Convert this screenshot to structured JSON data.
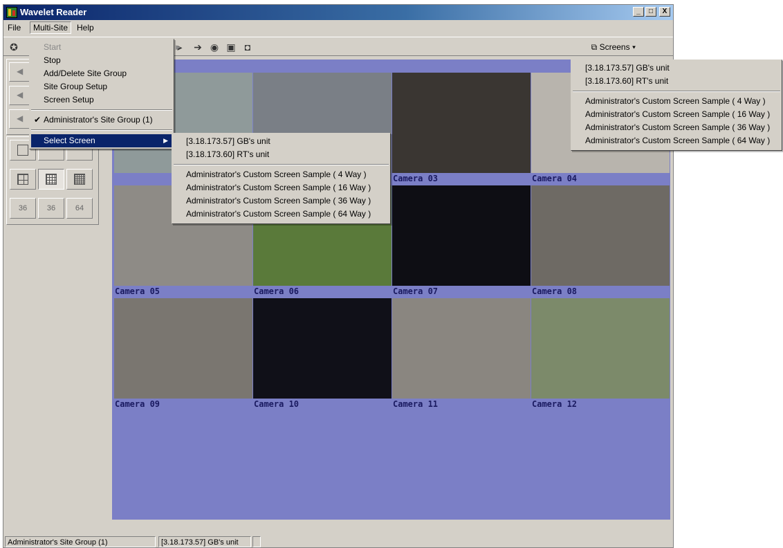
{
  "window": {
    "title": "Wavelet Reader",
    "controls": [
      "_",
      "□",
      "X"
    ]
  },
  "menubar": {
    "items": [
      "File",
      "Multi-Site",
      "Help"
    ]
  },
  "toolbar": {
    "screens_label": "Screens"
  },
  "multisite_menu": {
    "items": [
      {
        "label": "Start",
        "disabled": true,
        "submenu": true
      },
      {
        "label": "Stop"
      },
      {
        "label": "Add/Delete Site Group"
      },
      {
        "label": "Site Group Setup"
      },
      {
        "label": "Screen Setup"
      },
      {
        "label": "Administrator's Site Group (1)",
        "checked": true
      },
      {
        "label": "Select Screen",
        "highlighted": true,
        "submenu": true
      }
    ]
  },
  "select_screen_submenu": {
    "units": [
      "[3.18.173.57] GB's unit",
      "[3.18.173.60] RT's unit"
    ],
    "screens": [
      "Administrator's Custom Screen Sample ( 4 Way )",
      "Administrator's Custom Screen Sample ( 16 Way )",
      "Administrator's Custom Screen Sample ( 36 Way )",
      "Administrator's Custom Screen Sample ( 64 Way )"
    ]
  },
  "screens_dropdown": {
    "units": [
      "[3.18.173.57] GB's unit",
      "[3.18.173.60] RT's unit"
    ],
    "screens": [
      "Administrator's Custom Screen Sample ( 4 Way )",
      "Administrator's Custom Screen Sample ( 16 Way )",
      "Administrator's Custom Screen Sample ( 36 Way )",
      "Administrator's Custom Screen Sample ( 64 Way )"
    ]
  },
  "left_panel": {
    "layout_buttons": [
      "36",
      "36",
      "64"
    ]
  },
  "cameras": [
    {
      "label": "",
      "color": "#8f9a9a"
    },
    {
      "label": "",
      "color": "#7a7f86"
    },
    {
      "label": "Camera 03",
      "color": "#3a3632"
    },
    {
      "label": "Camera 04",
      "color": "#b8b4ad"
    },
    {
      "label": "Camera 05",
      "color": "#8e8b86"
    },
    {
      "label": "Camera 06",
      "color": "#5a7a3a"
    },
    {
      "label": "Camera 07",
      "color": "#0e0e14"
    },
    {
      "label": "Camera 08",
      "color": "#6e6a64"
    },
    {
      "label": "Camera 09",
      "color": "#7a7670"
    },
    {
      "label": "Camera 10",
      "color": "#101018"
    },
    {
      "label": "Camera 11",
      "color": "#8a8680"
    },
    {
      "label": "Camera 12",
      "color": "#7c8a6a"
    }
  ],
  "statusbar": {
    "group": "Administrator's Site Group (1)",
    "unit": "[3.18.173.57] GB's unit"
  }
}
